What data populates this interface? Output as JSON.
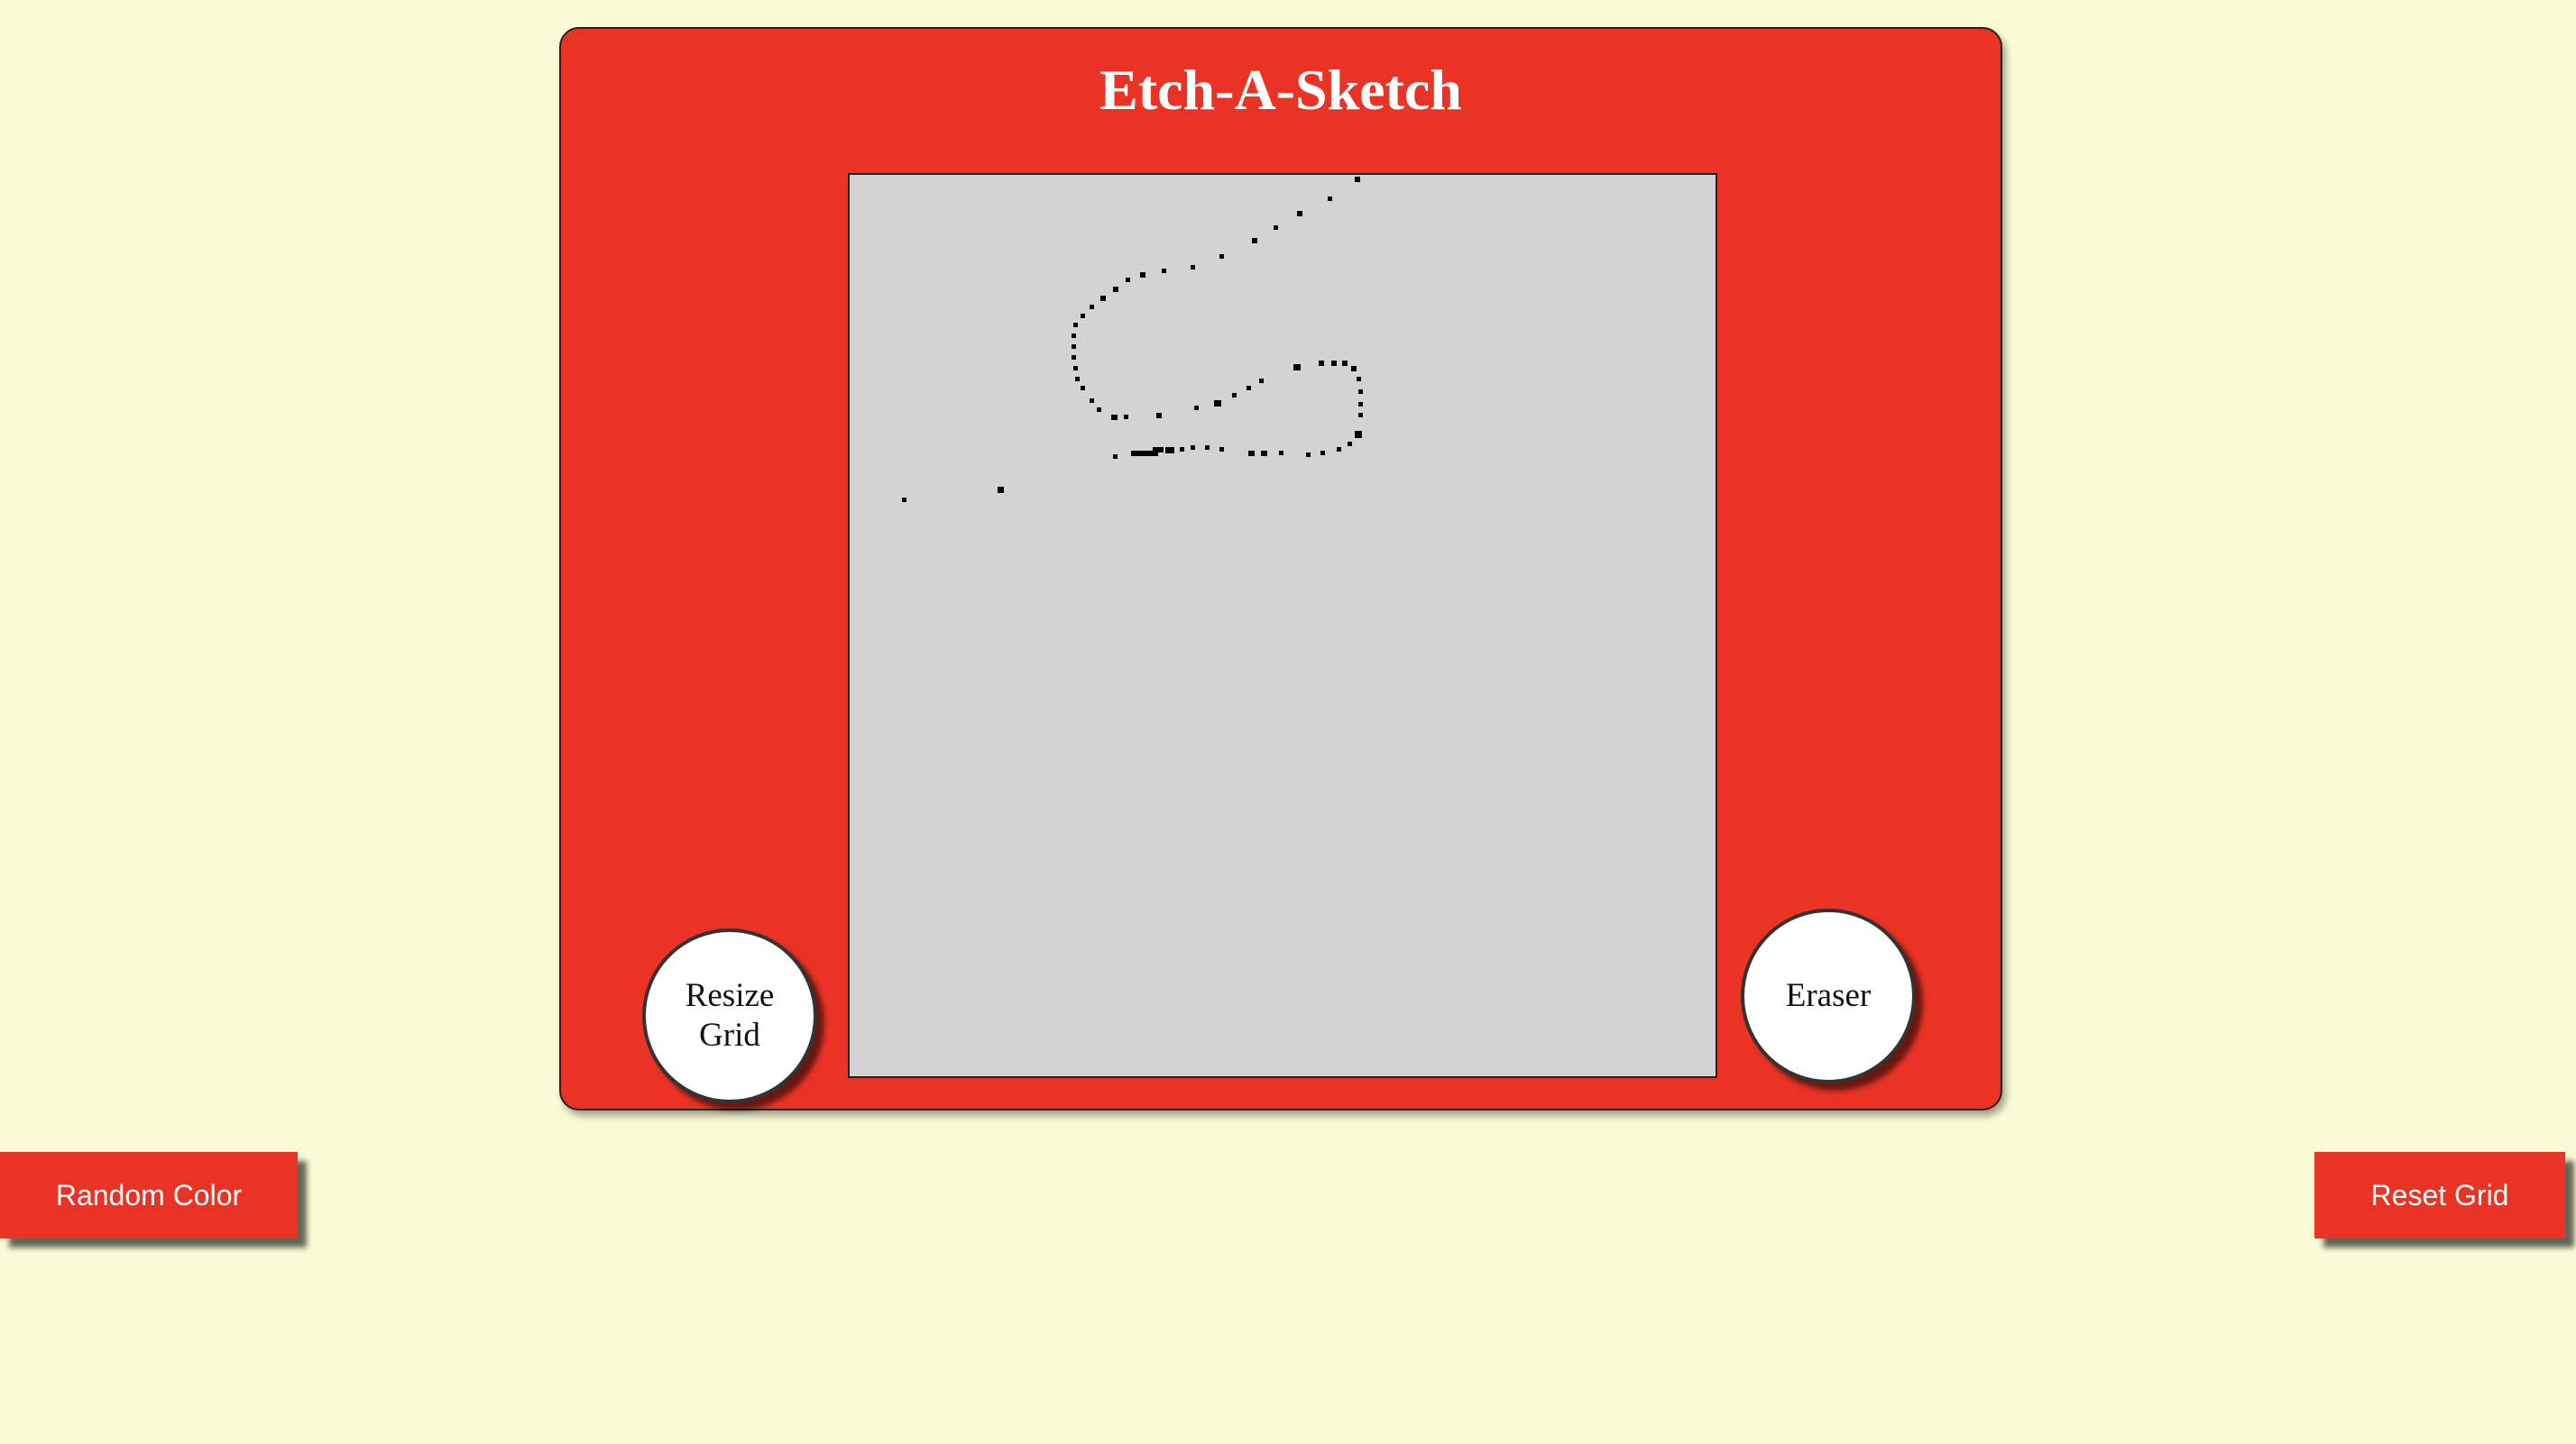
{
  "app": {
    "title": "Etch-A-Sketch"
  },
  "knobs": {
    "resize_label": "Resize Grid",
    "eraser_label": "Eraser"
  },
  "buttons": {
    "random_color_label": "Random Color",
    "reset_grid_label": "Reset Grid"
  },
  "colors": {
    "background": "#fafad4",
    "frame": "#ea3324",
    "screen": "#d3d3d3",
    "ink": "#000000"
  }
}
